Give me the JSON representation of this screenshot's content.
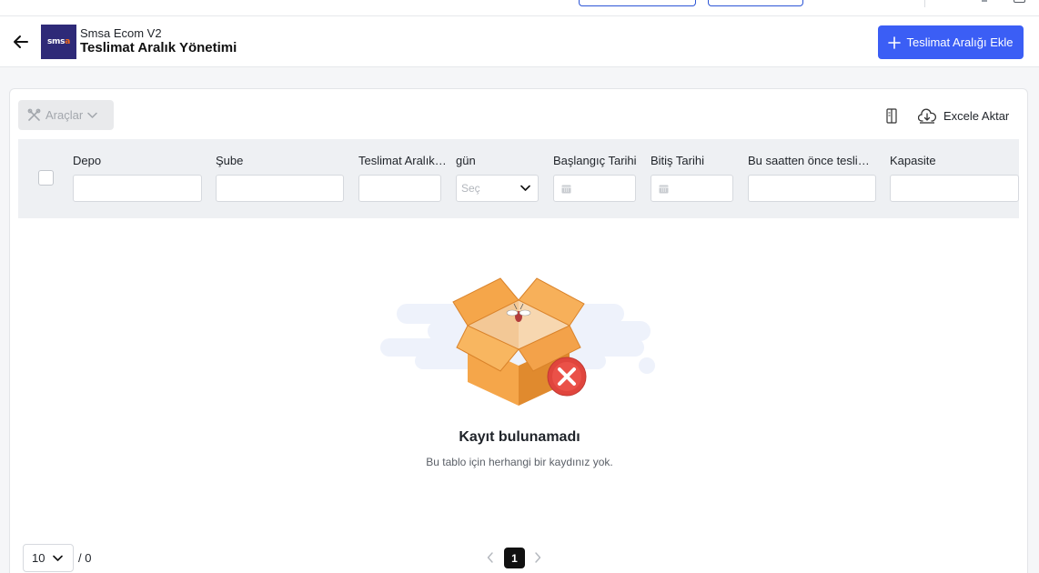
{
  "header": {
    "app_name": "Smsa Ecom V2",
    "page_title": "Teslimat Aralık Yönetimi",
    "add_button": "Teslimat Aralığı Ekle",
    "logo_text_a": "sms",
    "logo_text_b": "a",
    "logo_bg": "#2e2a78",
    "logo_accent": "#f06a1d"
  },
  "toolbar": {
    "tools_label": "Araçlar",
    "excel_label": "Excele Aktar"
  },
  "columns": [
    {
      "label": "Depo",
      "type": "text"
    },
    {
      "label": "Şube",
      "type": "text"
    },
    {
      "label": "Teslimat Aralık…",
      "type": "text"
    },
    {
      "label": "gün",
      "type": "select",
      "placeholder": "Seç"
    },
    {
      "label": "Başlangıç Tarihi",
      "type": "date"
    },
    {
      "label": "Bitiş Tarihi",
      "type": "date"
    },
    {
      "label": "Bu saatten önce tesli…",
      "type": "text"
    },
    {
      "label": "Kapasite",
      "type": "text"
    }
  ],
  "empty": {
    "title": "Kayıt bulunamadı",
    "description": "Bu tablo için herhangi bir kaydınız yok."
  },
  "pagination": {
    "page_size": "10",
    "total": "/ 0",
    "current_page": "1"
  },
  "colors": {
    "primary": "#3b5ef5",
    "header_bg": "#eef0f3"
  }
}
